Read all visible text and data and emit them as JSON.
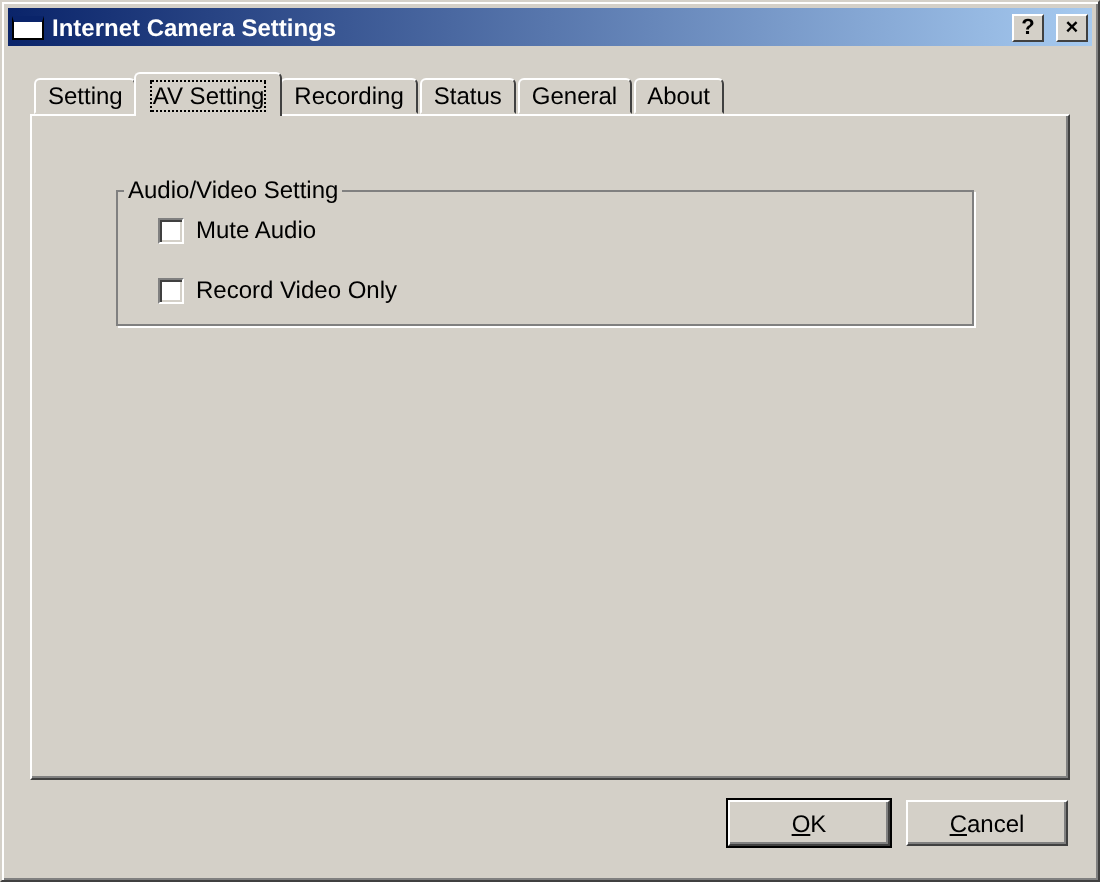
{
  "window": {
    "title": "Internet Camera Settings",
    "help_button": "?",
    "close_button": "×"
  },
  "tabs": [
    {
      "label": "Setting",
      "selected": false
    },
    {
      "label": "AV Setting",
      "selected": true
    },
    {
      "label": "Recording",
      "selected": false
    },
    {
      "label": "Status",
      "selected": false
    },
    {
      "label": "General",
      "selected": false
    },
    {
      "label": "About",
      "selected": false
    }
  ],
  "group": {
    "title": "Audio/Video Setting",
    "options": [
      {
        "label": "Mute Audio",
        "checked": false
      },
      {
        "label": "Record Video Only",
        "checked": false
      }
    ]
  },
  "buttons": [
    {
      "label": "OK",
      "default": true
    },
    {
      "label": "Cancel",
      "default": false
    }
  ]
}
